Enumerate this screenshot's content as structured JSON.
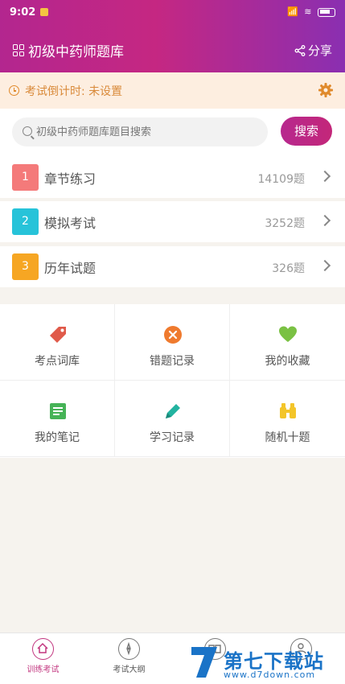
{
  "status_bar": {
    "time": "9:02",
    "signal": "📶",
    "wifi": "≋"
  },
  "header": {
    "title": "初级中药师题库",
    "share_label": "分享"
  },
  "countdown": {
    "text": "考试倒计时: 未设置"
  },
  "search": {
    "placeholder": "初级中药师题库题目搜索",
    "button_label": "搜索"
  },
  "list": [
    {
      "index": "1",
      "label": "章节练习",
      "count": "14109题",
      "color": "#f47a7a"
    },
    {
      "index": "2",
      "label": "模拟考试",
      "count": "3252题",
      "color": "#27c3d9"
    },
    {
      "index": "3",
      "label": "历年试题",
      "count": "326题",
      "color": "#f6a623"
    }
  ],
  "grid": [
    {
      "label": "考点词库",
      "icon": "tag-icon",
      "color": "#e05a4a"
    },
    {
      "label": "错题记录",
      "icon": "x-circle-icon",
      "color": "#ef7a2e"
    },
    {
      "label": "我的收藏",
      "icon": "heart-icon",
      "color": "#7ac143"
    },
    {
      "label": "我的笔记",
      "icon": "note-icon",
      "color": "#46b357"
    },
    {
      "label": "学习记录",
      "icon": "pencil-icon",
      "color": "#22b3a0"
    },
    {
      "label": "随机十题",
      "icon": "binoculars-icon",
      "color": "#f3c52a"
    }
  ],
  "tabs": [
    {
      "label": "训练考试",
      "icon": "home-icon",
      "active": true
    },
    {
      "label": "考试大纲",
      "icon": "compass-icon",
      "active": false
    },
    {
      "label": "",
      "icon": "book-icon",
      "active": false
    },
    {
      "label": "",
      "icon": "user-icon",
      "active": false
    }
  ],
  "watermark": {
    "text": "第七下载站",
    "url": "www.d7down.com"
  },
  "colors": {
    "brand": "#c32779",
    "header_end": "#8a2fb1",
    "countdown_bg": "#fdeee0",
    "countdown_text": "#d98a3a"
  }
}
